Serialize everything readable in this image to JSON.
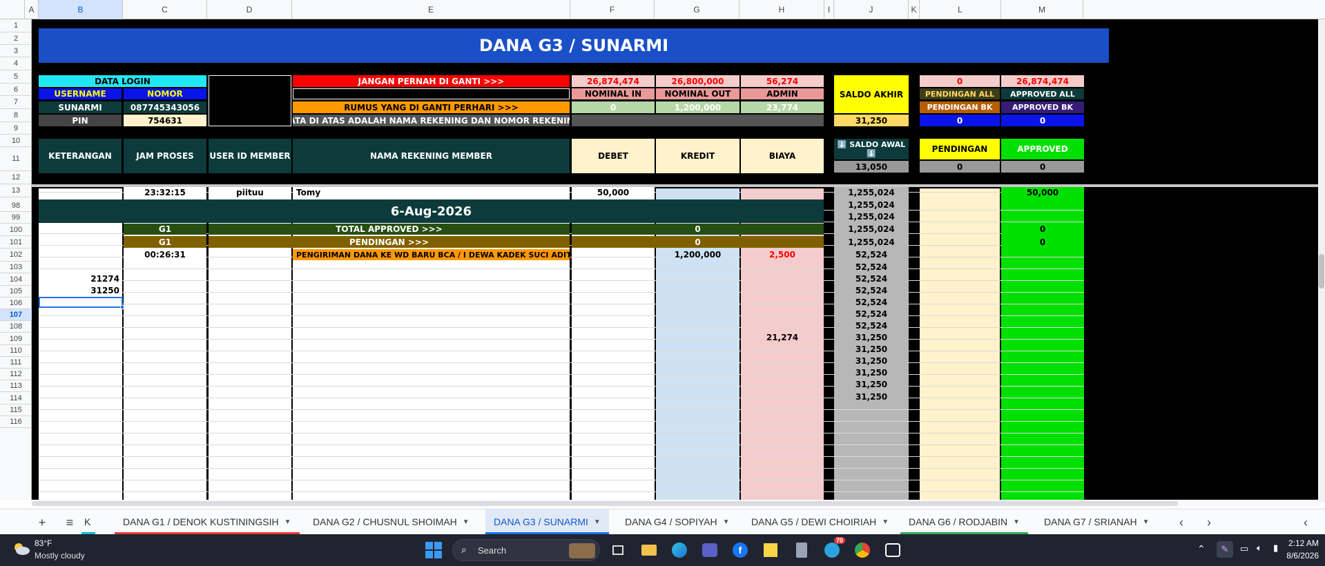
{
  "column_headers": [
    "A",
    "B",
    "C",
    "D",
    "E",
    "F",
    "G",
    "H",
    "I",
    "J",
    "K",
    "L",
    "M"
  ],
  "row_headers_top": [
    "1",
    "2",
    "3",
    "4",
    "5",
    "6",
    "7",
    "8",
    "9",
    "10",
    "11",
    "12",
    "13"
  ],
  "row_headers_body": [
    "98",
    "99",
    "100",
    "101",
    "102",
    "103",
    "104",
    "105",
    "106",
    "107",
    "108",
    "109",
    "110",
    "111",
    "112",
    "113",
    "114",
    "115",
    "116"
  ],
  "title": "DANA G3 / SUNARMI",
  "login": {
    "header": "DATA LOGIN",
    "username_label": "USERNAME",
    "nomor_label": "NOMOR",
    "username": "SUNARMI",
    "nomor": "087745343056",
    "pin_label": "PIN",
    "pin": "754631"
  },
  "notes": {
    "warning": "JANGAN PERNAH DI GANTI >>>",
    "daily_formula": "RUMUS YANG DI GANTI PERHARI >>>",
    "account_info": "DATA DI ATAS ADALAH NAMA REKENING DAN NOMOR REKENING"
  },
  "summary": {
    "nominal_in_value": "26,874,474",
    "nominal_out_value": "26,800,000",
    "admin_value": "56,274",
    "nominal_in_label": "NOMINAL IN",
    "nominal_out_label": "NOMINAL OUT",
    "admin_label": "ADMIN",
    "daily_in": "0",
    "daily_out": "1,200,000",
    "daily_admin": "23,774"
  },
  "saldo": {
    "akhir_label": "SALDO AKHIR",
    "akhir_value": "31,250",
    "awal_label": "⬇️ SALDO AWAL ⬇️",
    "awal_value": "13,050"
  },
  "status": {
    "pending_all_value": "0",
    "approved_all_value": "26,874,474",
    "pending_all_label": "PENDINGAN ALL",
    "approved_all_label": "APPROVED ALL",
    "pending_bk_label": "PENDINGAN BK",
    "approved_bk_label": "APPROVED BK",
    "pending_bk_value": "0",
    "approved_bk_value": "0",
    "pendingan_label": "PENDINGAN",
    "approved_label": "APPROVED",
    "pendingan_value": "0",
    "approved_value": "0"
  },
  "table_headers": {
    "keterangan": "KETERANGAN",
    "jam_proses": "JAM PROSES",
    "user_id": "USER ID MEMBER",
    "nama_rekening": "NAMA REKENING MEMBER",
    "debet": "DEBET",
    "kredit": "KREDIT",
    "biaya": "BIAYA"
  },
  "rows": {
    "r98": {
      "jam": "23:32:15",
      "user": "piituu",
      "nama": "Tomy",
      "debet": "50,000",
      "saldo": "1,255,024",
      "approved": "50,000"
    },
    "date_banner": "6-Aug-2026",
    "r101": {
      "group": "G1",
      "label": "TOTAL APPROVED >>>",
      "value": "0",
      "approved": "0"
    },
    "r102": {
      "group": "G1",
      "label": "PENDINGAN >>>",
      "value": "0",
      "approved": "0"
    },
    "r103": {
      "jam": "00:26:31",
      "nama": "PENGIRIMAN DANA KE  WD BARU BCA / I DEWA KADEK SUCI ADITAMA",
      "kredit": "1,200,000",
      "biaya": "2,500"
    },
    "r105_ket": "21274",
    "r106_ket": "31250",
    "r110_biaya": "21,274"
  },
  "saldo_column": [
    "1,255,024",
    "1,255,024",
    "1,255,024",
    "1,255,024",
    "1,255,024",
    "52,524",
    "52,524",
    "52,524",
    "52,524",
    "52,524",
    "52,524",
    "52,524",
    "31,250",
    "31,250",
    "31,250",
    "31,250",
    "31,250",
    "31,250"
  ],
  "sheet_tabs": {
    "partial": "K",
    "tabs": [
      "DANA G1 / DENOK KUSTININGSIH",
      "DANA G2 / CHUSNUL SHOIMAH",
      "DANA G3 / SUNARMI",
      "DANA G4 / SOPIYAH",
      "DANA G5 / DEWI CHOIRIAH",
      "DANA G6 / RODJABIN",
      "DANA G7 / SRIANAH"
    ],
    "active_index": 2,
    "underline_colors": [
      "#e53935",
      "#ffffff",
      "#1a73e8",
      "#ffffff",
      "#ffffff",
      "#34a853",
      "#ffffff"
    ]
  },
  "taskbar": {
    "weather_temp": "83°F",
    "weather_desc": "Mostly cloudy",
    "search_label": "Search",
    "time": "2:12 AM",
    "date": "8/6/2026",
    "telegram_badge": "70"
  },
  "colors": {
    "title_blue": "#1a4fc7",
    "dark_teal": "#0d3b3b",
    "cyan": "#22e8f5",
    "yellow": "#ffff00",
    "green": "#00e000",
    "orange": "#ff9900",
    "red": "#ff0000"
  }
}
